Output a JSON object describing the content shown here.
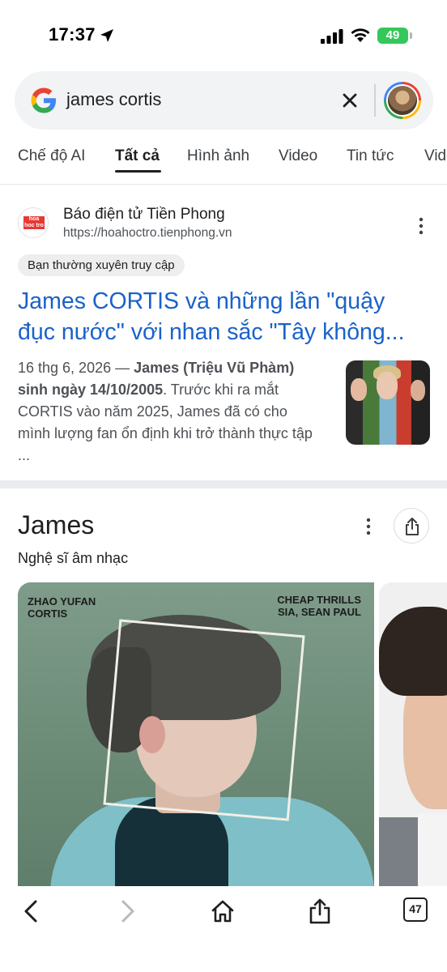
{
  "status_bar": {
    "time": "17:37",
    "battery": "49",
    "icons": [
      "location-arrow-icon",
      "signal-icon",
      "wifi-icon",
      "battery-charging-icon"
    ]
  },
  "search": {
    "query": "james cortis",
    "icons": [
      "google-logo-icon",
      "clear-icon",
      "account-avatar"
    ]
  },
  "tabs": [
    {
      "label": "Chế độ AI",
      "active": false
    },
    {
      "label": "Tất cả",
      "active": true
    },
    {
      "label": "Hình ảnh",
      "active": false
    },
    {
      "label": "Video",
      "active": false
    },
    {
      "label": "Tin tức",
      "active": false
    },
    {
      "label": "Vid",
      "active": false
    }
  ],
  "result": {
    "favicon_text": "hoa hoc tro",
    "site_name": "Báo điện tử Tiền Phong",
    "url": "https://hoahoctro.tienphong.vn",
    "badge": "Bạn thường xuyên truy cập",
    "title": "James CORTIS và những lần \"quậy đục nước\" với nhan sắc \"Tây không...",
    "snippet_date": "16 thg 6, 2026",
    "snippet_dash": " — ",
    "snippet_bold": "James (Triệu Vũ Phàm) sinh ngày 14/10/2005",
    "snippet_rest": ". Trước khi ra mắt CORTIS vào năm 2025, James đã có cho mình lượng fan ổn định khi trở thành thực tập ..."
  },
  "knowledge_panel": {
    "title": "James",
    "subtitle": "Nghệ sĩ âm nhạc",
    "image_caption_left_1": "ZHAO YUFAN",
    "image_caption_left_2": "CORTIS",
    "image_caption_right_1": "CHEAP THRILLS",
    "image_caption_right_2": "SIA, SEAN PAUL"
  },
  "bottom_bar": {
    "tabs_count": "47",
    "icons": [
      "back-icon",
      "forward-icon",
      "home-icon",
      "share-icon",
      "tabs-icon"
    ]
  },
  "colors": {
    "link_blue": "#1a62c9",
    "battery_green": "#34c759",
    "search_bg": "#f1f3f4"
  }
}
